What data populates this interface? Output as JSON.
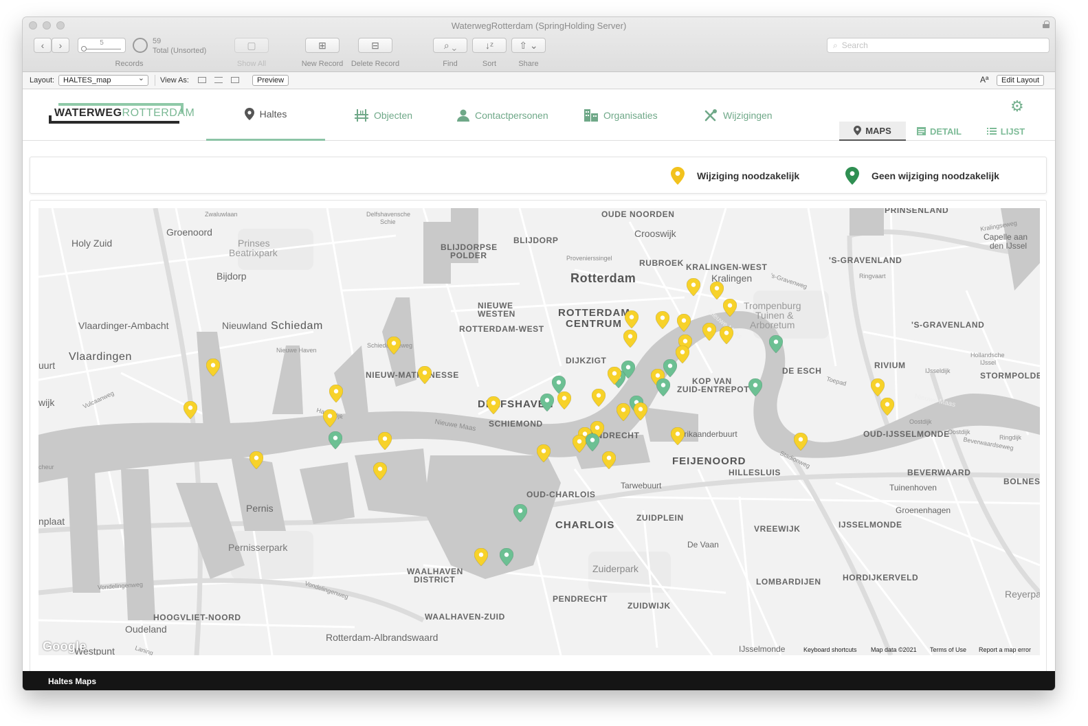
{
  "window": {
    "title": "WaterwegRotterdam (SpringHolding Server)"
  },
  "toolbar": {
    "record_value": "5",
    "total_count": "59",
    "total_label": "Total (Unsorted)",
    "records_label": "Records",
    "show_all": "Show All",
    "new_record": "New Record",
    "delete_record": "Delete Record",
    "find": "Find",
    "sort": "Sort",
    "share": "Share",
    "search_placeholder": "Search"
  },
  "layoutbar": {
    "layout_label": "Layout:",
    "layout_value": "HALTES_map",
    "view_as_label": "View As:",
    "preview": "Preview",
    "font_icon": "Aª",
    "edit_layout": "Edit Layout"
  },
  "app": {
    "logo_left": "WATERWEG",
    "logo_right": "ROTTERDAM",
    "nav": [
      {
        "label": "Haltes",
        "icon": "map-pin-icon",
        "active": true
      },
      {
        "label": "Objecten",
        "icon": "bridge-icon",
        "active": false
      },
      {
        "label": "Contactpersonen",
        "icon": "person-icon",
        "active": false
      },
      {
        "label": "Organisaties",
        "icon": "building-icon",
        "active": false
      },
      {
        "label": "Wijzigingen",
        "icon": "tools-icon",
        "active": false
      }
    ],
    "views": [
      {
        "label": "MAPS",
        "icon": "map-pin-icon",
        "active": true
      },
      {
        "label": "DETAIL",
        "icon": "detail-icon",
        "active": false
      },
      {
        "label": "LIJST",
        "icon": "list-icon",
        "active": false
      }
    ]
  },
  "legend": {
    "yellow_label": "Wijziging noodzakelijk",
    "green_label": "Geen wijziging noodzakelijk",
    "yellow_color": "#f7d22a",
    "green_color": "#6cc093"
  },
  "map": {
    "places": {
      "groenoord": "Groenoord",
      "holy_zuid": "Holy Zuid",
      "prinses": "Prinses",
      "beatrixpark": "Beatrixpark",
      "bijdorp": "Bijdorp",
      "vlaardinger_ambacht": "Vlaardinger-Ambacht",
      "nieuwland": "Nieuwland",
      "schiedam": "Schiedam",
      "vlaardingen": "Vlaardingen",
      "uurt": "uurt",
      "wijk": "wijk",
      "pernis": "Pernis",
      "pernisserpark": "Pernisserpark",
      "nplaat": "nplaat",
      "hoogvliet_noord": "HOOGVLIET-NOORD",
      "oudeland": "Oudeland",
      "westpunt": "Westpunt",
      "rotterdam_albrandswaard": "Rotterdam-Albrandswaard",
      "waalhaven_zuid": "WAALHAVEN-ZUID",
      "waalhaven_district_1": "WAALHAVEN",
      "waalhaven_district_2": "DISTRICT",
      "pendrecht": "PENDRECHT",
      "zuidwijk": "ZUIDWIJK",
      "blijdorpse_polder_1": "BLIJDORPSE",
      "blijdorpse_polder_2": "POLDER",
      "blijdorp": "BLIJDORP",
      "oude_noorden": "OUDE NOORDEN",
      "crooswijk": "Crooswijk",
      "rubroek": "RUBROEK",
      "rotterdam": "Rotterdam",
      "kralingen_west": "KRALINGEN-WEST",
      "kralingen": "Kralingen",
      "nieuwe_westen_1": "NIEUWE",
      "nieuwe_westen_2": "WESTEN",
      "rotterdam_centrum_1": "ROTTERDAM",
      "rotterdam_centrum_2": "CENTRUM",
      "rotterdam_west": "ROTTERDAM-WEST",
      "dijkzigt": "DIJKZIGT",
      "nieuw_mathenesse": "NIEUW-MATHENESSE",
      "delfshaven": "DELFSHAVEN",
      "schiemond": "SCHIEMOND",
      "nieuwe_maas_1": "Nieuwe Maas",
      "nieuwe_maas_2": "Nieuwe Maas",
      "nieuwe_maas_3": "Nieuwe Maas",
      "feijenoord_label": "FEIJENOORD",
      "hillesluis": "HILLESLUIS",
      "afrikaanderbuurt": "Afrikaanderbuurt",
      "kop_van_zuid_1": "KOP VAN",
      "kop_van_zuid_2": "ZUID-ENTREPOT",
      "tarwebuurt": "Tarwebuurt",
      "oud_charlois": "OUD-CHARLOIS",
      "charlois": "CHARLOIS",
      "zuidplein": "ZUIDPLEIN",
      "vreewijk": "VREEWIJK",
      "de_vaan": "De Vaan",
      "zuiderpark": "Zuiderpark",
      "lombardijen": "LOMBARDIJEN",
      "hordijkerveld": "HORDIJKERVELD",
      "ijsselmonde_district": "IJSSELMONDE",
      "ijsselmonde_town": "IJsselmonde",
      "groenenhagen": "Groenenhagen",
      "tuinenhoven": "Tuinenhoven",
      "beverwaard": "BEVERWAARD",
      "bolnes": "BOLNES",
      "reyerpa": "Reyerpa",
      "oud_ijsselmonde": "OUD-IJSSELMONDE",
      "rivium": "RIVIUM",
      "stormpolder": "STORMPOLDER",
      "de_esch": "DE ESCH",
      "s_gravenland_1": "'S-GRAVENLAND",
      "s_gravenland_2": "'S-GRAVENLAND",
      "prinsenland": "PRINSENLAND",
      "capelle_1": "Capelle aan",
      "capelle_2": "den IJssel",
      "trompenburg_1": "Trompenburg",
      "trompenburg_2": "Tuinen &",
      "trompenburg_3": "Arboretum",
      "oud_charlois_extra": "",
      "fendrecht": "ENDRECHT",
      "scheur": "cheur"
    },
    "streets": {
      "zwaluwlaan": "Zwaluwlaan",
      "vulcaanweg": "Vulcaanweg",
      "havendijk": "Havendijk",
      "nieuwe_haven": "Nieuwe Haven",
      "schiedamseweg": "Schiedamseweg",
      "vondelingenweg_1": "Vondelingenweg",
      "vondelingenweg_2": "Vondelingenweg",
      "laning": "Laning",
      "stadionweg": "Stadionweg",
      "toepad": "Toepad",
      "ringvaart": "Ringvaart",
      "kralingseweg": "Kralingseweg",
      "gravenweg": "'s-Gravenweg",
      "oostdijk_1": "Oostdijk",
      "oostdijk_2": "Oostdijk",
      "ringdijk": "Ringdijk",
      "beverwaardseweg": "Beverwaardseweg",
      "ijsseldijk": "IJsseldijk",
      "provenierssingel": "Provenierssingel",
      "delfshavense_schie_1": "Delfshavensche",
      "delfshavense_schie_2": "Schie",
      "hollandsche_ijssel_1": "Hollandsche",
      "hollandsche_ijssel_2": "IJssel"
    },
    "attribution": {
      "google": "Google",
      "keyboard": "Keyboard shortcuts",
      "mapdata": "Map data ©2021",
      "terms": "Terms of Use",
      "report": "Report a map error"
    }
  },
  "footer": {
    "label": "Haltes Maps"
  }
}
